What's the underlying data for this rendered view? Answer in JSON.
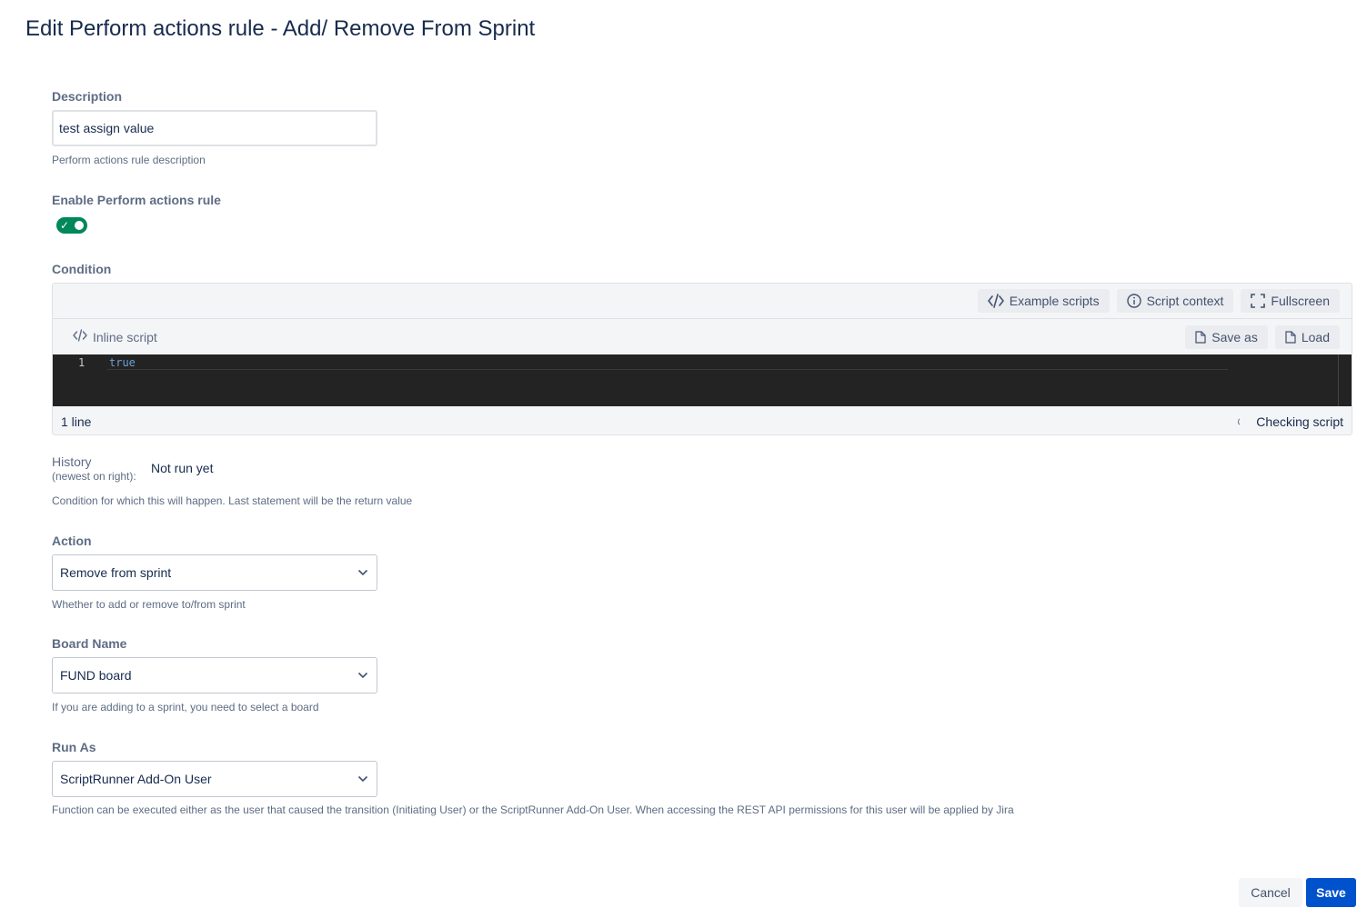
{
  "page": {
    "title": "Edit Perform actions rule - Add/ Remove From Sprint"
  },
  "description": {
    "label": "Description",
    "value": "test assign value",
    "helper": "Perform actions rule description"
  },
  "enable": {
    "label": "Enable Perform actions rule",
    "enabled": true
  },
  "condition": {
    "label": "Condition",
    "toolbar": {
      "example_scripts": "Example scripts",
      "script_context": "Script context",
      "fullscreen": "Fullscreen"
    },
    "editor": {
      "mode_label": "Inline script",
      "save_as": "Save as",
      "load": "Load",
      "line_numbers": [
        "1"
      ],
      "code_lines": [
        "true"
      ],
      "line_count": "1 line",
      "status": "Checking script"
    },
    "history": {
      "label": "History",
      "sublabel": "(newest on right):",
      "value": "Not run yet"
    },
    "helper": "Condition for which this will happen. Last statement will be the return value"
  },
  "action": {
    "label": "Action",
    "selected": "Remove from sprint",
    "helper": "Whether to add or remove to/from sprint"
  },
  "board": {
    "label": "Board Name",
    "selected": "FUND board",
    "helper": "If you are adding to a sprint, you need to select a board"
  },
  "run_as": {
    "label": "Run As",
    "selected": "ScriptRunner Add-On User",
    "helper": "Function can be executed either as the user that caused the transition (Initiating User) or the ScriptRunner Add-On User. When accessing the REST API permissions for this user will be applied by Jira"
  },
  "footer": {
    "cancel": "Cancel",
    "save": "Save"
  },
  "colors": {
    "primary": "#0052cc",
    "toggle_on": "#00875a",
    "editor_bg": "#232323",
    "text": "#172b4d",
    "subtle_text": "#5e6c84"
  }
}
